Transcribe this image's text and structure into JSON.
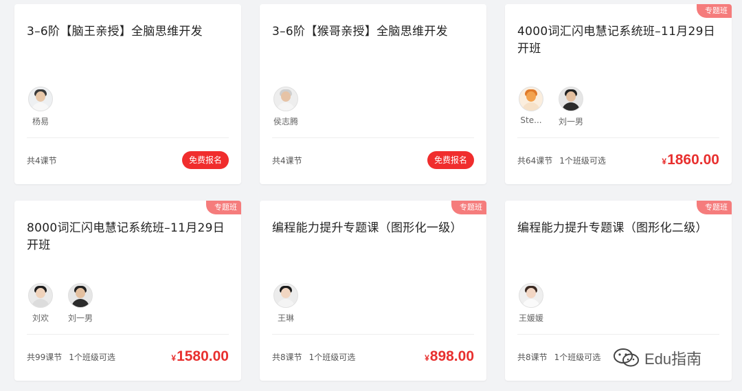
{
  "cards": [
    {
      "title": "3–6阶【脑王亲授】全脑思维开发",
      "tag": "",
      "teachers": [
        {
          "name": "杨易"
        }
      ],
      "lessons": "共4课节",
      "classes": "",
      "action": "免费报名",
      "price": ""
    },
    {
      "title": "3–6阶【猴哥亲授】全脑思维开发",
      "tag": "",
      "teachers": [
        {
          "name": "侯志腾"
        }
      ],
      "lessons": "共4课节",
      "classes": "",
      "action": "免费报名",
      "price": ""
    },
    {
      "title": "4000词汇闪电慧记系统班–11月29日开班",
      "tag": "专题班",
      "teachers": [
        {
          "name": "Ste..."
        },
        {
          "name": "刘一男"
        }
      ],
      "lessons": "共64课节",
      "classes": "1个班级可选",
      "action": "",
      "price_symbol": "¥",
      "price": "1860.00"
    },
    {
      "title": "8000词汇闪电慧记系统班–11月29日开班",
      "tag": "专题班",
      "teachers": [
        {
          "name": "刘欢"
        },
        {
          "name": "刘一男"
        }
      ],
      "lessons": "共99课节",
      "classes": "1个班级可选",
      "action": "",
      "price_symbol": "¥",
      "price": "1580.00"
    },
    {
      "title": "编程能力提升专题课（图形化一级）",
      "tag": "专题班",
      "teachers": [
        {
          "name": "王琳"
        }
      ],
      "lessons": "共8课节",
      "classes": "1个班级可选",
      "action": "",
      "price_symbol": "¥",
      "price": "898.00"
    },
    {
      "title": "编程能力提升专题课（图形化二级）",
      "tag": "专题班",
      "teachers": [
        {
          "name": "王媛媛"
        }
      ],
      "lessons": "共8课节",
      "classes": "1个班级可选",
      "action": "",
      "price_symbol": "",
      "price": ""
    }
  ],
  "watermark": {
    "text": "Edu指南",
    "icon": "wechat-icon"
  },
  "colors": {
    "accent": "#f02d2d",
    "price": "#e8302f",
    "tag": "#f57c7c"
  }
}
